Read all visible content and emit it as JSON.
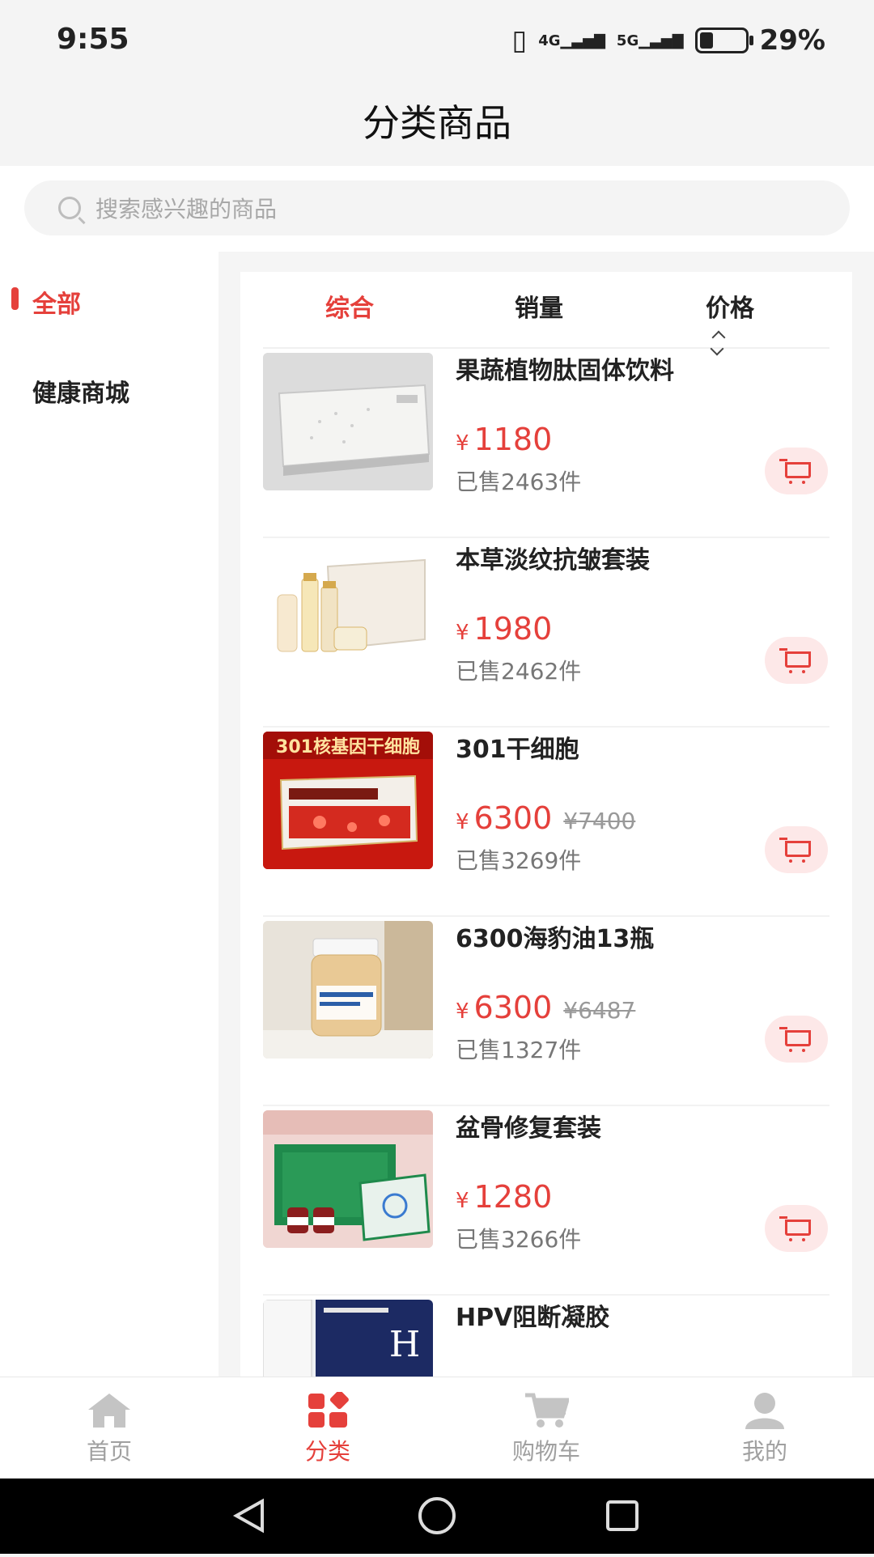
{
  "status": {
    "time": "9:55",
    "net1": "4G",
    "net2": "5G",
    "battery": "29%",
    "battery_level": 0.29
  },
  "header": {
    "title": "分类商品"
  },
  "search": {
    "placeholder": "搜索感兴趣的商品"
  },
  "categories": [
    {
      "label": "全部",
      "active": true
    },
    {
      "label": "健康商城",
      "active": false
    }
  ],
  "sort_tabs": [
    {
      "label": "综合",
      "active": true
    },
    {
      "label": "销量",
      "active": false
    },
    {
      "label": "价格",
      "active": false
    }
  ],
  "products": [
    {
      "name": "果蔬植物肽固体饮料",
      "currency": "¥",
      "price": "1180",
      "original_price": "",
      "sold": "已售2463件"
    },
    {
      "name": "本草淡纹抗皱套装",
      "currency": "¥",
      "price": "1980",
      "original_price": "",
      "sold": "已售2462件"
    },
    {
      "name": "301干细胞",
      "currency": "¥",
      "price": "6300",
      "original_price": "¥7400",
      "sold": "已售3269件",
      "image_text": "301核基因干细胞"
    },
    {
      "name": "6300海豹油13瓶",
      "currency": "¥",
      "price": "6300",
      "original_price": "¥6487",
      "sold": "已售1327件"
    },
    {
      "name": "盆骨修复套装",
      "currency": "¥",
      "price": "1280",
      "original_price": "",
      "sold": "已售3266件"
    },
    {
      "name": "HPV阻断凝胶",
      "currency": "¥",
      "price": "",
      "original_price": "",
      "sold": ""
    }
  ],
  "tabbar": [
    {
      "label": "首页",
      "icon": "home-icon",
      "active": false
    },
    {
      "label": "分类",
      "icon": "category-icon",
      "active": true
    },
    {
      "label": "购物车",
      "icon": "cart-icon",
      "active": false
    },
    {
      "label": "我的",
      "icon": "user-icon",
      "active": false
    }
  ],
  "colors": {
    "accent": "#e5403b",
    "background": "#f5f5f5"
  }
}
